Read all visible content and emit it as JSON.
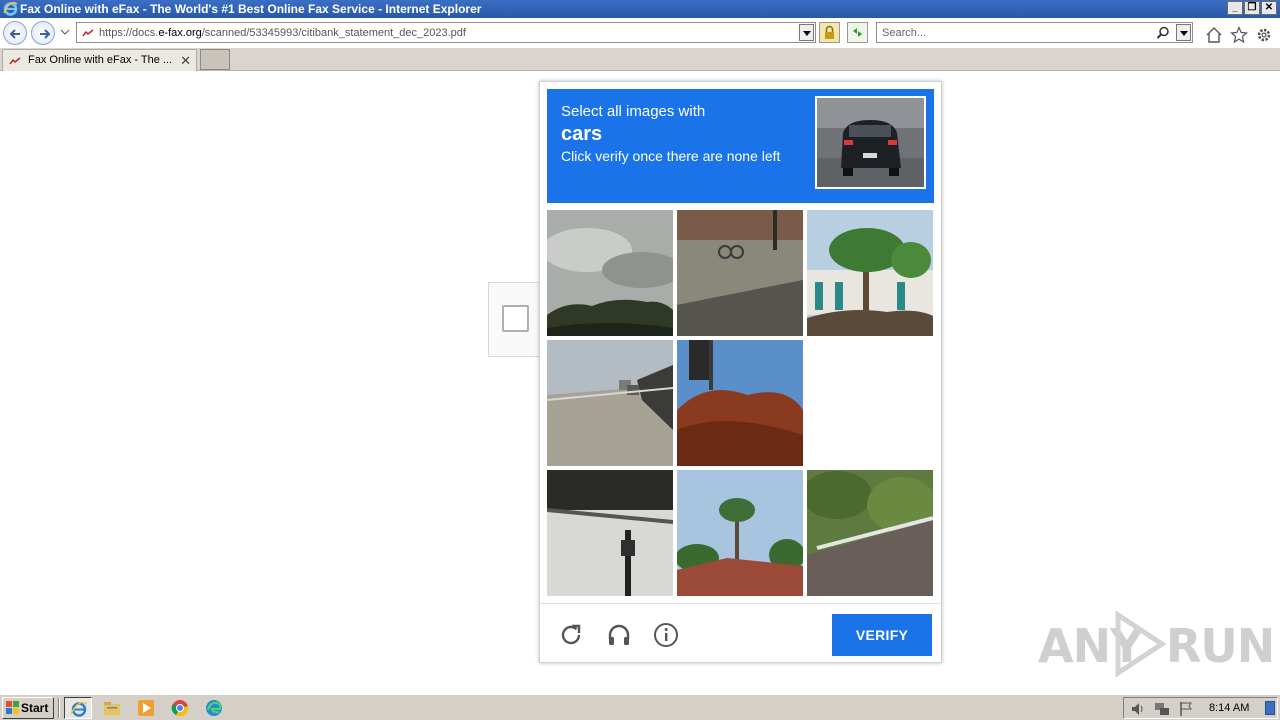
{
  "window": {
    "title": "Fax Online with eFax - The World's #1 Best Online Fax Service - Internet Explorer",
    "controls": [
      "_",
      "❐",
      "✕"
    ]
  },
  "address_bar": {
    "url_prefix": "https://docs.",
    "url_domain": "e-fax.org",
    "url_path": "/scanned/53345993/citibank_statement_dec_2023.pdf"
  },
  "search": {
    "placeholder": "Search..."
  },
  "tabs": [
    {
      "label": "Fax Online with eFax - The ...",
      "close": "✕"
    }
  ],
  "captcha": {
    "prompt_line1": "Select all images with",
    "target": "cars",
    "prompt_line3": "Click verify once there are none left",
    "verify_label": "VERIFY",
    "tiles": [
      "sky-trees",
      "street-sidewalk",
      "palm-building",
      "highway-cars",
      "traffic-light-tree",
      "empty",
      "bridge-underside",
      "palm-roof",
      "road-guardrail"
    ]
  },
  "watermark": {
    "text": "ANY RUN"
  },
  "taskbar": {
    "start_label": "Start",
    "clock": "8:14 AM",
    "apps": [
      "internet-explorer",
      "file-explorer",
      "media-player",
      "chrome",
      "edge"
    ]
  }
}
